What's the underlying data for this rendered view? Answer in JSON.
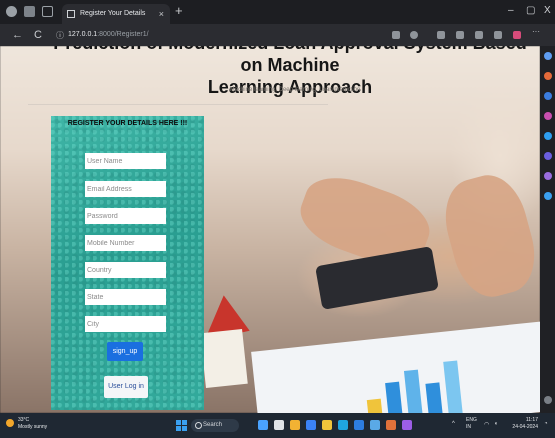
{
  "browser": {
    "tab_title": "Register Your Details",
    "tab_close": "×",
    "new_tab": "+",
    "win_min": "–",
    "win_max": "▢",
    "win_close": "X",
    "back": "←",
    "refresh": "C",
    "address_host": "127.0.0.1",
    "address_rest": ":8000/Register1/"
  },
  "page": {
    "title_line1": "Prediction of Modernized Loan Approval System Based on Machine",
    "title_line2": "Learning Approach",
    "subtitle": "Machine learning, Deep learning, Loan prediction"
  },
  "form": {
    "heading": "REGISTER YOUR DETAILS HERE !!!",
    "placeholders": {
      "user_name": "User Name",
      "email": "Email Address",
      "password": "Password",
      "mobile": "Mobile Number",
      "country": "Country",
      "state": "State",
      "city": "City"
    },
    "signup_label": "sign_up",
    "login_label": "User Log in"
  },
  "taskbar": {
    "weather_temp": "33°C",
    "weather_desc": "Mostly sunny",
    "search_label": "Search",
    "tray_lang": "ENG",
    "tray_region": "IN",
    "time": "11:17",
    "date": "24-04-2024"
  },
  "colors": {
    "form_teal": "#2a9e91",
    "signup_blue": "#1a6fe0",
    "taskbar": "#1f2833"
  }
}
